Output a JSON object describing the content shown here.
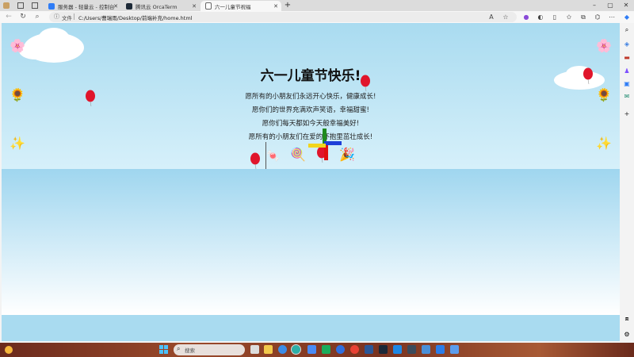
{
  "browser": {
    "tabs": [
      {
        "title": "服务器 - 轻量云 - 控制台",
        "active": false
      },
      {
        "title": "腾讯云 OrcaTerm",
        "active": false
      },
      {
        "title": "六一儿童节祝福",
        "active": true
      }
    ],
    "address_label": "文件",
    "url": "C:/Users/曹瑞雨/Desktop/前端补充/home.html"
  },
  "page": {
    "title": "六一儿童节快乐!",
    "wishes": [
      "愿所有的小朋友们永远开心快乐，健康成长!",
      "愿你们的世界充满欢声笑语，幸福甜蜜!",
      "愿你们每天都如今天般幸福美好!",
      "愿所有的小朋友们在爱的怀抱里茁壮成长!"
    ],
    "decor_emoji": {
      "flower": "🌸",
      "sunflower": "🌻",
      "sparkles": "✨",
      "candy": "🍬",
      "lollipop": "🍭",
      "party": "🎉"
    }
  },
  "taskbar": {
    "search_placeholder": "搜索",
    "clock_time": "",
    "clock_date": ""
  },
  "colors": {
    "sky_top": "#a9dbf0",
    "balloon_red": "#e0152b",
    "pinwheel_green": "#1f8a1f",
    "pinwheel_red": "#e01010",
    "pinwheel_blue": "#1d3fd8",
    "pinwheel_yellow": "#f2d51c"
  }
}
